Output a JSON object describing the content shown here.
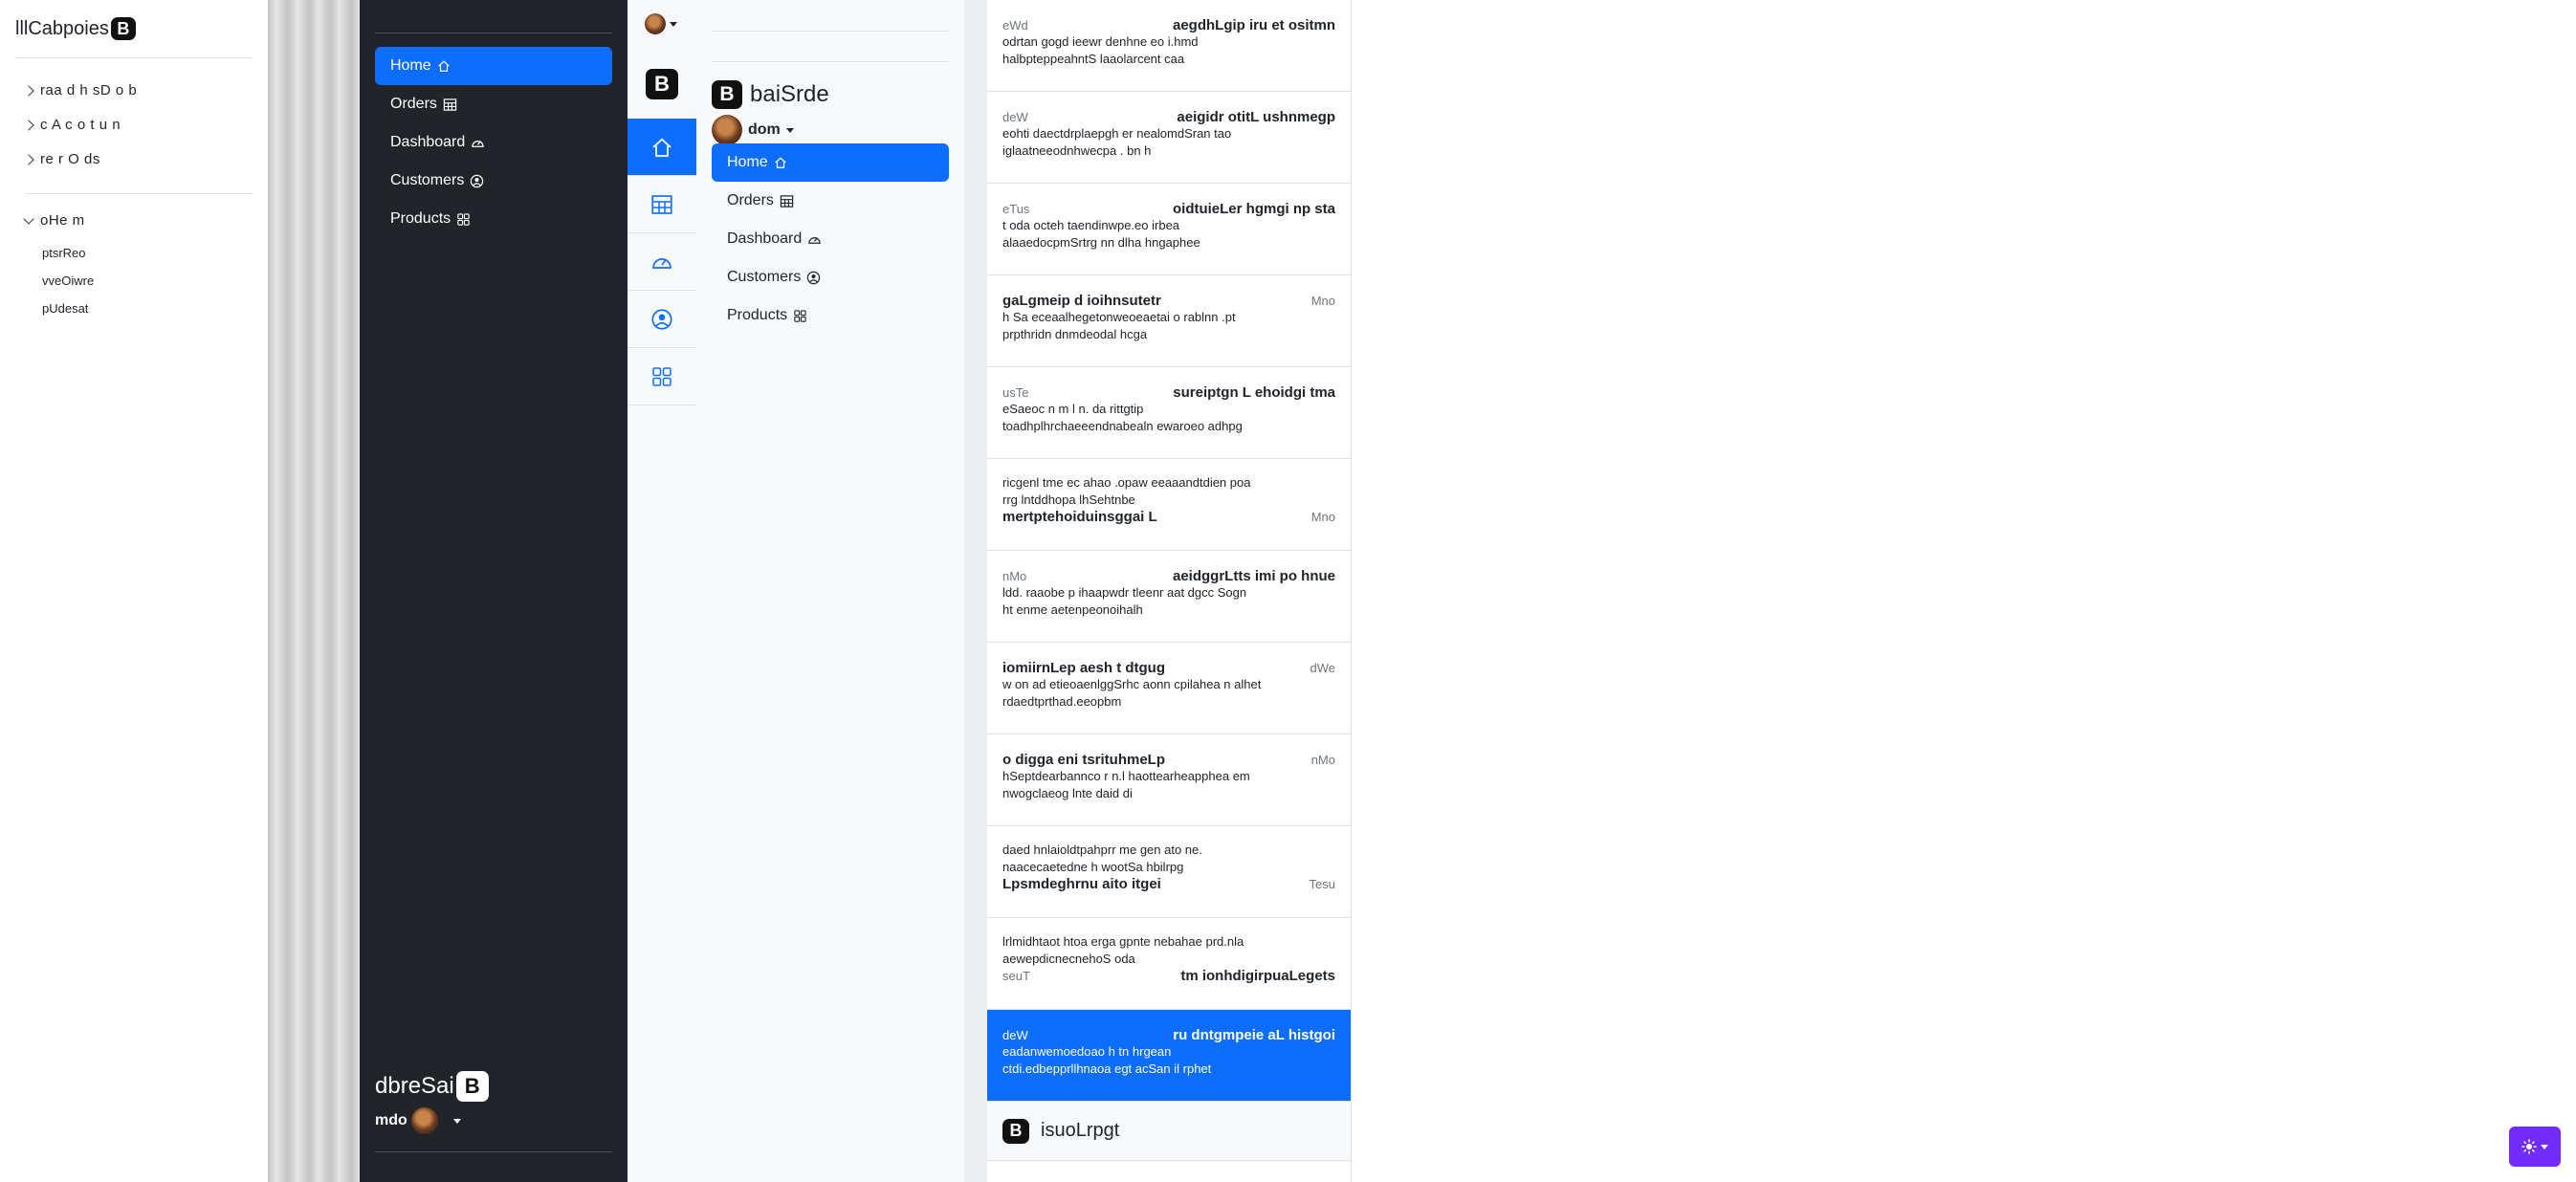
{
  "panel1": {
    "brand": "lllCabpoies",
    "brand_mark": "B",
    "tree": [
      {
        "label": "raa d h sD o b",
        "expanded": false
      },
      {
        "label": "c A c o t u n",
        "expanded": false
      },
      {
        "label": "re r O ds",
        "expanded": false
      }
    ],
    "open_group": {
      "label": "oHe m",
      "expanded": true,
      "links": [
        "ptsrReo",
        "vveOiwre",
        "pUdesat"
      ]
    }
  },
  "panel2": {
    "nav": [
      {
        "label": "Home",
        "icon": "house-icon",
        "active": true
      },
      {
        "label": "Orders",
        "icon": "table-icon",
        "active": false
      },
      {
        "label": "Dashboard",
        "icon": "speedometer-icon",
        "active": false
      },
      {
        "label": "Customers",
        "icon": "person-circle-icon",
        "active": false
      },
      {
        "label": "Products",
        "icon": "grid-icon",
        "active": false
      }
    ],
    "brand": "dbreSai",
    "brand_mark": "B",
    "user": "mdo"
  },
  "panel3": {
    "brand_mark": "B",
    "icons": [
      "house-icon",
      "table-icon",
      "speedometer-icon",
      "person-circle-icon",
      "grid-icon"
    ],
    "active_index": 0
  },
  "panel4": {
    "brand": "baiSrde",
    "brand_mark": "B",
    "user": "dom",
    "nav": [
      {
        "label": "Home",
        "icon": "house-icon",
        "active": true
      },
      {
        "label": "Orders",
        "icon": "table-icon",
        "active": false
      },
      {
        "label": "Dashboard",
        "icon": "speedometer-icon",
        "active": false
      },
      {
        "label": "Customers",
        "icon": "person-circle-icon",
        "active": false
      },
      {
        "label": "Products",
        "icon": "grid-icon",
        "active": false
      }
    ]
  },
  "panel5": {
    "items": [
      {
        "layout": "date-left",
        "date": "eWd",
        "title": "aegdhLgip iru et ositmn",
        "lines": [
          "odrtan gogd ieewr denhne eo i.hmd",
          "halbpteppeahntS laaolarcent caa"
        ]
      },
      {
        "layout": "date-left",
        "date": "deW",
        "title": "aeigidr otitL ushnmegp",
        "lines": [
          "eohti daectdrplaepgh er nealomdSran tao",
          "iglaatneeodnhwecpa . bn h"
        ]
      },
      {
        "layout": "date-left",
        "date": "eTus",
        "title": "oidtuieLer hgmgi np sta",
        "lines": [
          "t oda octeh taendinwpe.eo irbea",
          "alaaedocpmSrtrg nn dlha hngaphee"
        ]
      },
      {
        "layout": "title-left",
        "date": "Mno",
        "title": "gaLgmeip d ioihnsutetr",
        "lines": [
          "h Sa eceaalhegetonweoeaetai o rablnn .pt",
          "prpthridn dnmdeodal hcga"
        ]
      },
      {
        "layout": "date-left",
        "date": "usTe",
        "title": "sureiptgn L ehoidgi tma",
        "lines": [
          "eSaeoc n m l n. da rittgtip",
          "toadhplhrchaeeendnabealn ewaroeo adhpg"
        ]
      },
      {
        "layout": "text-first",
        "date": "Mno",
        "title": "mertptehoiduinsggai L",
        "lines": [
          "ricgenl tme ec ahao .opaw eeaaandtdien poa",
          "rrg lntddhopa lhSehtnbe"
        ]
      },
      {
        "layout": "date-left",
        "date": "nMo",
        "title": "aeidggrLtts imi po hnue",
        "lines": [
          "ldd. raaobe p ihaapwdr tleenr aat dgcc Sogn",
          "ht enme aetenpeonoihalh"
        ]
      },
      {
        "layout": "title-left",
        "date": "dWe",
        "title": "iomiirnLep aesh t dtgug",
        "lines": [
          "w on ad etieoaenlggSrhc aonn cpilahea n alhet",
          "rdaedtprthad.eeopbm"
        ]
      },
      {
        "layout": "title-left",
        "date": "nMo",
        "title": "o digga eni tsrituhmeLp",
        "lines": [
          "hSeptdearbannco r n.l haottearheapphea em",
          "nwogclaeog lnte daid di"
        ]
      },
      {
        "layout": "text-first",
        "date": "Tesu",
        "title": "Lpsmdeghrnu aito itgei",
        "lines": [
          "daed hnlaioldtpahprr me gen ato ne.",
          "naacecaetedne h wootSa hbilrpg"
        ]
      },
      {
        "layout": "text-first-left",
        "date": "seuT",
        "title": "tm ionhdigirpuaLegets",
        "lines": [
          "lrlmidhtaot htoa erga gpnte nebahae prd.nla",
          "aewepdicnecnehoS oda"
        ]
      },
      {
        "layout": "date-left",
        "date": "deW",
        "title": "ru dntgmpeie aL histgoi",
        "lines": [
          "eadanwemoedoao h tn hrgean",
          "ctdi.edbepprllhnaoa egt acSan il rphet"
        ],
        "active": true
      }
    ],
    "footer_brand": "isuoLrpgt",
    "footer_mark": "B"
  },
  "colors": {
    "accent": "#0d6efd",
    "dark": "#212529",
    "theme_button": "#712cf9"
  },
  "theme_button": {
    "icon": "sun-icon"
  }
}
